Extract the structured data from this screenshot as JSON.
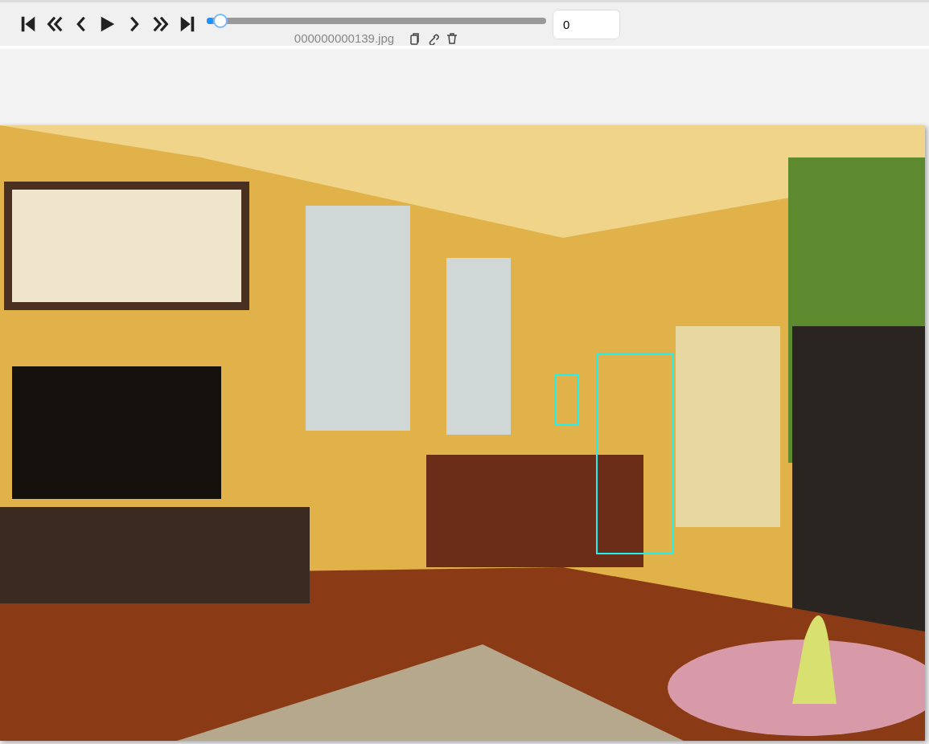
{
  "player": {
    "controls": [
      {
        "kind": "first"
      },
      {
        "kind": "back-many"
      },
      {
        "kind": "back"
      },
      {
        "kind": "play"
      },
      {
        "kind": "forward"
      },
      {
        "kind": "forward-many"
      },
      {
        "kind": "last"
      }
    ],
    "progress": {
      "level": 0.02
    },
    "filename": "000000000139.jpg",
    "frame_input": {
      "value": "0"
    }
  }
}
